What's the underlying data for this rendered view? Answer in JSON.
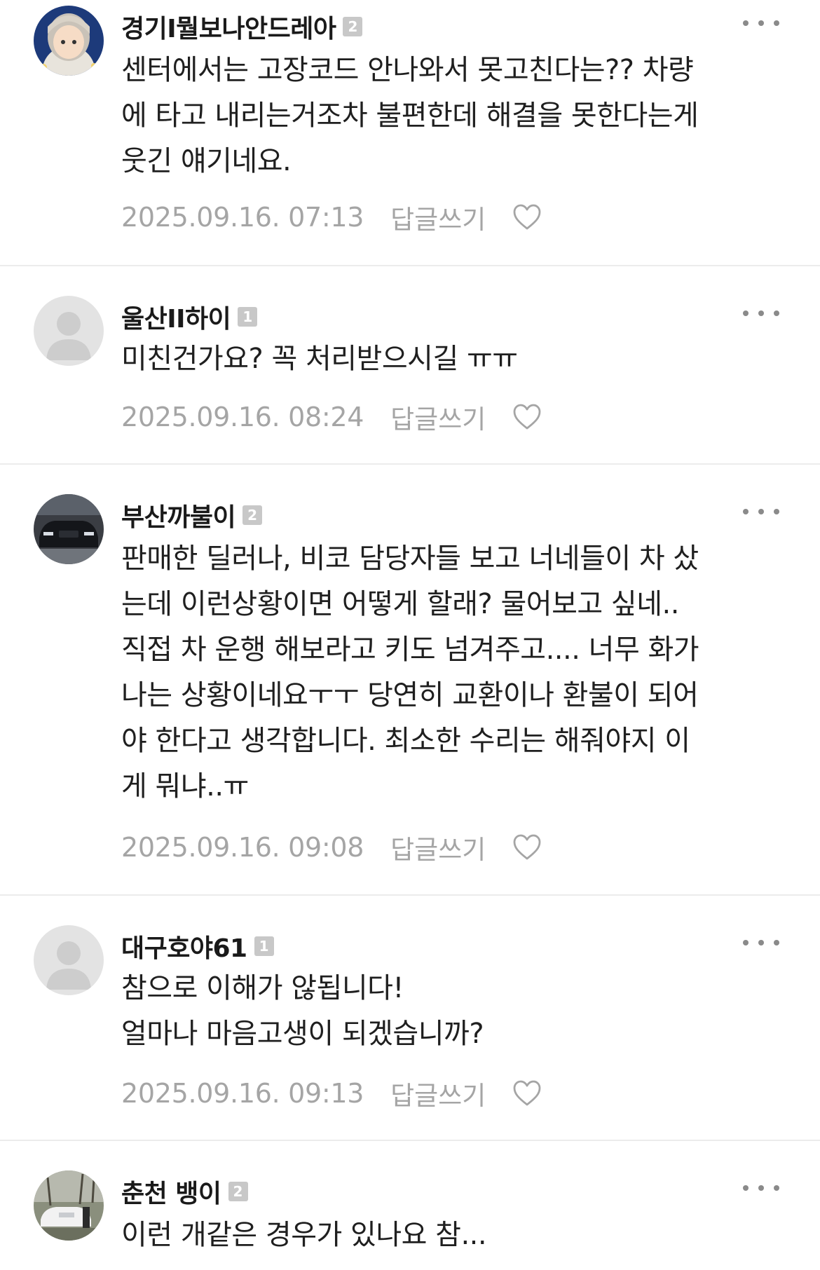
{
  "comments": [
    {
      "author": "경기I뭘보나안드레아",
      "level": "2",
      "text": "센터에서는 고장코드 안나와서 못고친다는?? 차량\n에 타고 내리는거조차 불편한데 해결을 못한다는게\n웃긴 얘기네요.",
      "date": "2025.09.16. 07:13",
      "reply_label": "답글쓰기",
      "avatar": "character-avatar-icon"
    },
    {
      "author": "울산II하이",
      "level": "1",
      "text": "미친건가요? 꼭 처리받으시길 ㅠㅠ",
      "date": "2025.09.16. 08:24",
      "reply_label": "답글쓰기",
      "avatar": "default-avatar-icon"
    },
    {
      "author": "부산까불이",
      "level": "2",
      "text": "판매한 딜러나, 비코 담당자들 보고 너네들이 차 샀\n는데 이런상황이면 어떻게 할래? 물어보고 싶네..\n직접 차 운행 해보라고 키도 넘겨주고.... 너무 화가\n나는 상황이네요ㅜㅜ 당연히 교환이나 환불이 되어\n야 한다고 생각합니다. 최소한 수리는 해줘야지 이\n게 뭐냐..ㅠ",
      "date": "2025.09.16. 09:08",
      "reply_label": "답글쓰기",
      "avatar": "car-photo-avatar-icon"
    },
    {
      "author": "대구호야61",
      "level": "1",
      "text": "참으로 이해가 않됩니다!\n얼마나 마음고생이 되겠습니까?",
      "date": "2025.09.16. 09:13",
      "reply_label": "답글쓰기",
      "avatar": "default-avatar-icon"
    },
    {
      "author": "춘천 뱅이",
      "level": "2",
      "text": "이런 개같은 경우가 있나요 참...",
      "date": "",
      "reply_label": "",
      "avatar": "car-photo-avatar-icon"
    }
  ],
  "icons": {
    "more": "more-dots-icon",
    "like": "heart-outline-icon"
  },
  "colors": {
    "text": "#1f1f1f",
    "muted": "#a5a5a5",
    "divider": "#ececec",
    "badge": "#c8c8c8"
  }
}
